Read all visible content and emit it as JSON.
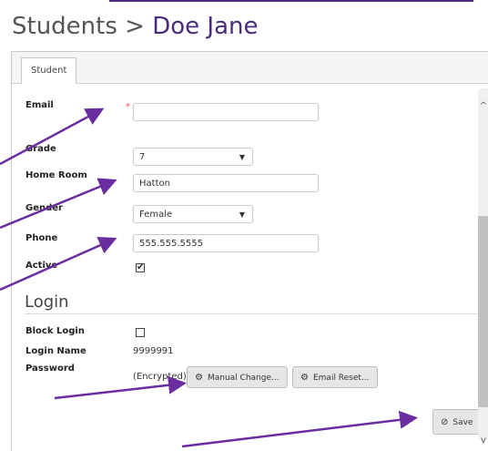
{
  "header": {
    "title_root": "Students",
    "separator": ">",
    "title_current": "Doe Jane"
  },
  "tabs": [
    {
      "label": "Student"
    }
  ],
  "form": {
    "email": {
      "label": "Email",
      "required_mark": "*",
      "value": ""
    },
    "grade": {
      "label": "Grade",
      "value": "7"
    },
    "home_room": {
      "label": "Home Room",
      "value": "Hatton"
    },
    "gender": {
      "label": "Gender",
      "value": "Female"
    },
    "phone": {
      "label": "Phone",
      "value": "555.555.5555"
    },
    "active": {
      "label": "Active",
      "checked": true,
      "check_glyph": "✔"
    }
  },
  "login": {
    "section_title": "Login",
    "block_login": {
      "label": "Block Login",
      "checked": false
    },
    "login_name": {
      "label": "Login Name",
      "value": "9999991"
    },
    "password": {
      "label": "Password",
      "value": "(Encrypted)"
    },
    "manual_change_button": "Manual Change...",
    "email_reset_button": "Email Reset..."
  },
  "actions": {
    "save_button": "Save"
  },
  "icons": {
    "gear": "gear-icon",
    "check_circle": "check-circle-icon",
    "dropdown": "chevron-down-icon"
  },
  "colors": {
    "brand": "#4b2c7a",
    "required": "#d9534f",
    "annotation_arrow": "#6a2c9e"
  }
}
